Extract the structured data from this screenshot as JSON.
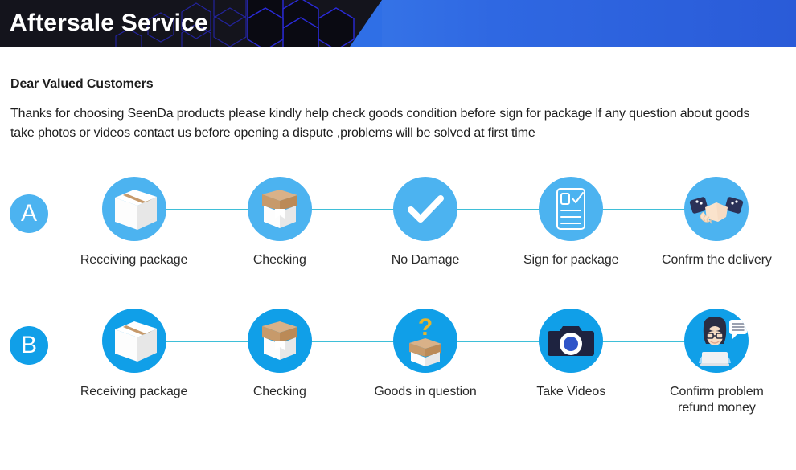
{
  "header": {
    "title": "Aftersale Service",
    "gradient_from": "#4aa3f7",
    "gradient_to": "#2a5bd8",
    "dark_bg": "#14141c",
    "hex_stroke": "#2a2ad8"
  },
  "intro": {
    "title": "Dear Valued Customers",
    "body": "Thanks for choosing SeenDa products please kindly help check goods condition before sign for package lf any question about goods take photos or videos contact us before opening a dispute ,problems will be solved at first time"
  },
  "colors": {
    "row_a_circle": "#4cb3f0",
    "row_b_circle": "#109fe8",
    "connector": "#3fbfd8",
    "label": "#2a2a2a",
    "box_white": "#f4f4f4",
    "box_tan": "#c79a6b",
    "box_tan_light": "#d9b188",
    "sleeve_navy": "#2b3157",
    "skin": "#f6dcc4",
    "question_yellow": "#e8b52a",
    "camera_body": "#1e2340",
    "camera_lens": "#2f54c8",
    "hair_dark": "#2a2d42"
  },
  "rows": [
    {
      "badge": "A",
      "badge_name": "row-badge-a",
      "circle_color": "#4cb3f0",
      "steps": [
        {
          "label": "Receiving package",
          "icon": "closed-box-icon"
        },
        {
          "label": "Checking",
          "icon": "open-box-icon"
        },
        {
          "label": "No Damage",
          "icon": "checkmark-icon"
        },
        {
          "label": "Sign for package",
          "icon": "clipboard-document-icon"
        },
        {
          "label": "Confrm the delivery",
          "icon": "handshake-icon"
        }
      ]
    },
    {
      "badge": "B",
      "badge_name": "row-badge-b",
      "circle_color": "#109fe8",
      "steps": [
        {
          "label": "Receiving package",
          "icon": "closed-box-icon"
        },
        {
          "label": "Checking",
          "icon": "open-box-icon"
        },
        {
          "label": "Goods in question",
          "icon": "question-box-icon"
        },
        {
          "label": "Take Videos",
          "icon": "camera-icon"
        },
        {
          "label": "Confirm problem\nrefund money",
          "icon": "support-agent-icon"
        }
      ]
    }
  ]
}
